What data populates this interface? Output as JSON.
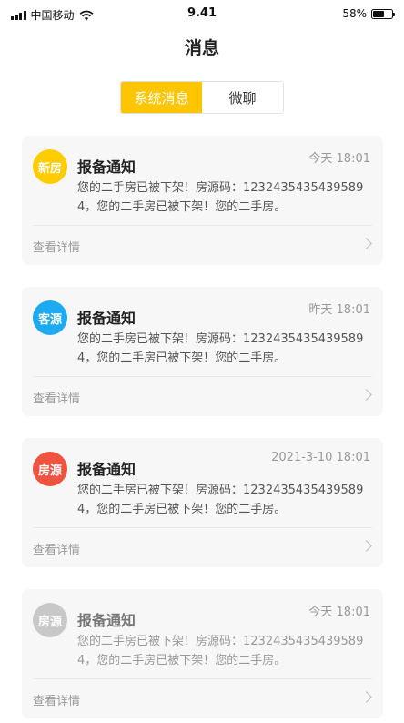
{
  "status_bar": {
    "carrier": "中国移动",
    "time": "9.41",
    "battery_percent_label": "58%",
    "battery_level": 0.58,
    "signal_bars": 4,
    "icons": [
      "signal-icon",
      "wifi-icon",
      "battery-icon"
    ]
  },
  "page_title": "消息",
  "tabs": [
    {
      "label": "系统消息",
      "active": true
    },
    {
      "label": "微聊",
      "active": false
    }
  ],
  "colors": {
    "accent": "#ffc600",
    "badge_new": "#ffcc00",
    "badge_customer": "#1eaaf1",
    "badge_house": "#f0533f",
    "badge_read": "#c8c8c8"
  },
  "messages": [
    {
      "badge": "新房",
      "badge_color": "#ffcc00",
      "title": "报备通知",
      "time": "今天 18:01",
      "body": "您的二手房已被下架！房源码：12324354354395894，您的二手房已被下架！您的二手房。",
      "link": "查看详情",
      "read": false
    },
    {
      "badge": "客源",
      "badge_color": "#1eaaf1",
      "title": "报备通知",
      "time": "昨天 18:01",
      "body": "您的二手房已被下架！房源码：12324354354395894，您的二手房已被下架！您的二手房。",
      "link": "查看详情",
      "read": false
    },
    {
      "badge": "房源",
      "badge_color": "#f0533f",
      "title": "报备通知",
      "time": "2021-3-10 18:01",
      "body": "您的二手房已被下架！房源码：12324354354395894，您的二手房已被下架！您的二手房。",
      "link": "查看详情",
      "read": false
    },
    {
      "badge": "房源",
      "badge_color": "#c8c8c8",
      "title": "报备通知",
      "time": "今天 18:01",
      "body": "您的二手房已被下架！房源码：12324354354395894，您的二手房已被下架！您的二手房。",
      "link": "查看详情",
      "read": true
    }
  ]
}
